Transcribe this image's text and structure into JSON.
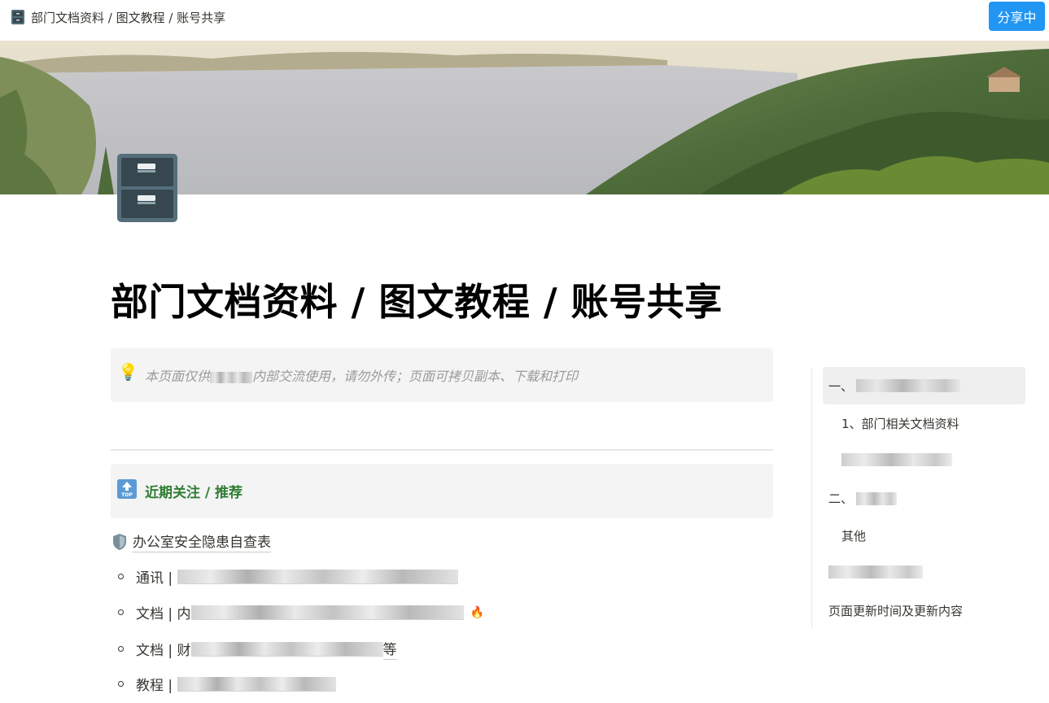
{
  "topbar": {
    "breadcrumb_icon": "file-cabinet-icon",
    "breadcrumb": "部门文档资料 / 图文教程 / 账号共享",
    "share_label": "分享中",
    "share_color": "#2196f3"
  },
  "page": {
    "icon": "file-cabinet-icon",
    "title": "部门文档资料 / 图文教程 / 账号共享"
  },
  "callout": {
    "icon": "lightbulb-icon",
    "text_before": "本页面仅供",
    "text_after": "内部交流使用，请勿外传；页面可拷贝副本、下载和打印"
  },
  "section": {
    "icon": "top-arrow-icon",
    "icon_label": "TOP",
    "title": "近期关注 / 推荐",
    "title_color": "#2e7d32"
  },
  "checklist": {
    "icon": "shield-icon",
    "label": "办公室安全隐患自查表"
  },
  "list": [
    {
      "prefix": "通讯 |",
      "icon": ""
    },
    {
      "prefix": "文档 | 内",
      "icon": "fire-icon",
      "trail": "🔥"
    },
    {
      "prefix": "文档 | 财",
      "suffix": "等"
    },
    {
      "prefix": "教程 |"
    }
  ],
  "toc": {
    "items": [
      {
        "label": "一、",
        "active": true
      },
      {
        "label": "1、部门相关文档资料"
      },
      {
        "label": ""
      },
      {
        "label": "二、"
      },
      {
        "label": "其他"
      },
      {
        "label": ""
      },
      {
        "label": "页面更新时间及更新内容"
      }
    ]
  }
}
